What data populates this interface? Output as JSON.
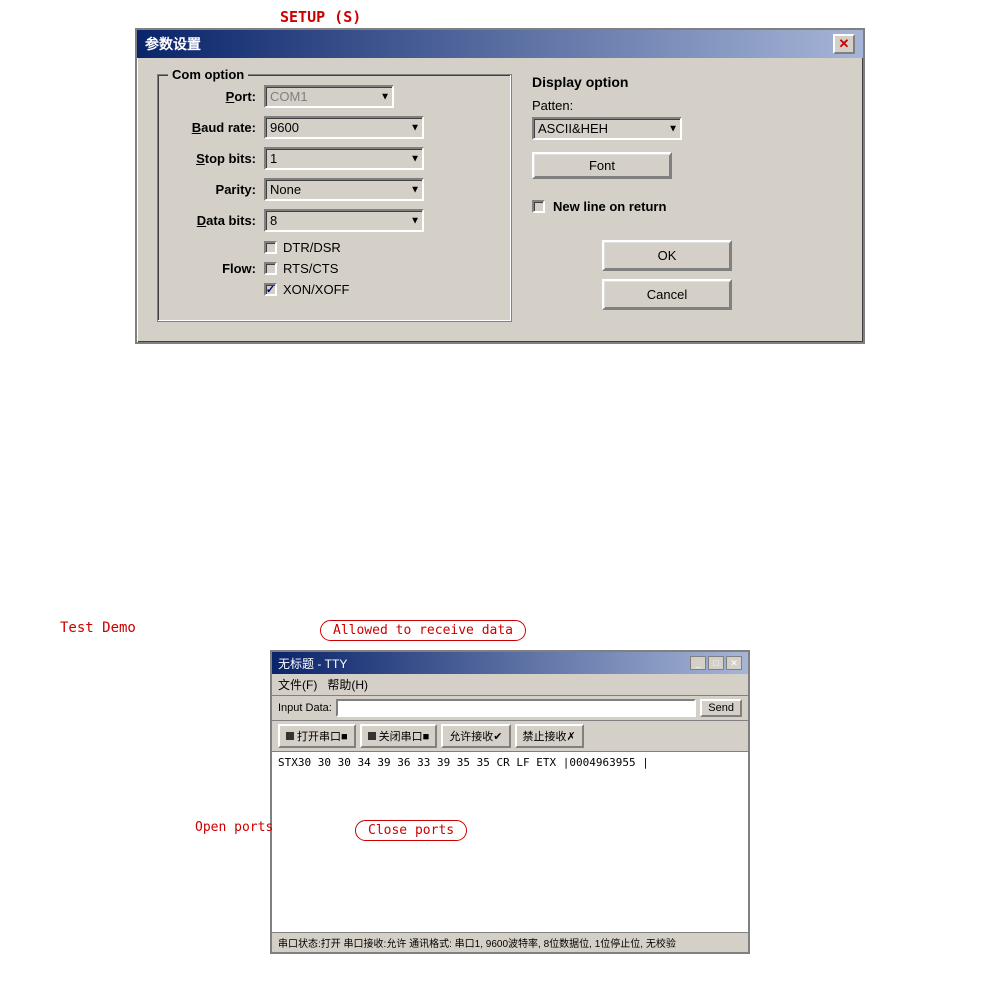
{
  "setup_label": "SETUP (S)",
  "dialog": {
    "title": "参数设置",
    "close_btn": "✕",
    "com_option": {
      "group_label": "Com option",
      "port_label": "Port:",
      "port_value": "COM1",
      "baud_label": "Baud rate:",
      "baud_value": "9600",
      "stop_label": "Stop bits:",
      "stop_value": "1",
      "parity_label": "Parity:",
      "parity_value": "None",
      "data_label": "Data bits:",
      "data_value": "8",
      "flow_label": "Flow:",
      "flow_options": [
        {
          "label": "DTR/DSR",
          "checked": false
        },
        {
          "label": "RTS/CTS",
          "checked": false
        },
        {
          "label": "XON/XOFF",
          "checked": true
        }
      ]
    },
    "display_option": {
      "section_title": "Display option",
      "patten_label": "Patten:",
      "patten_value": "ASCII&HEH",
      "font_btn": "Font",
      "new_line_label": "New line on return",
      "new_line_checked": false,
      "ok_btn": "OK",
      "cancel_btn": "Cancel"
    }
  },
  "bottom": {
    "test_demo": "Test Demo",
    "allowed_label": "Allowed to receive data",
    "inner_window": {
      "title": "无标题 - TTY",
      "menu_items": [
        "文件(F)",
        "帮助(H)"
      ],
      "input_label": "Input Data:",
      "send_btn": "Send",
      "buttons": [
        {
          "label": "打开串口■",
          "icon": true
        },
        {
          "label": "关闭串口■",
          "icon": true
        },
        {
          "label": "允许接收✔"
        },
        {
          "label": "禁止接收✗"
        }
      ],
      "content_line": "STX30 30 30 34 39 36 33 39 35 35 CR LF ETX     |0004963955  |",
      "statusbar": "串口状态:打开  串口接收:允许  通讯格式: 串口1, 9600波特率, 8位数据位, 1位停止位, 无校验"
    },
    "open_ports": "Open ports",
    "close_ports": "Close ports"
  }
}
